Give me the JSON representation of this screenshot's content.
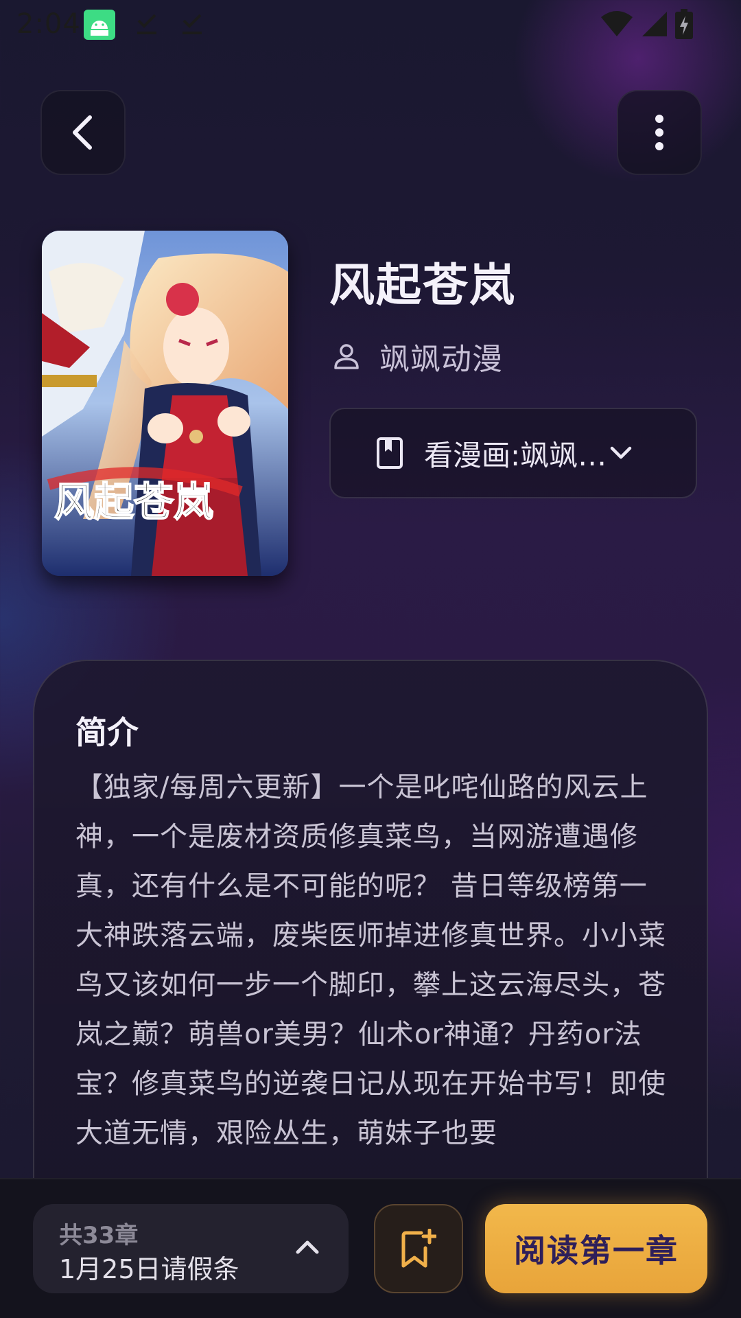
{
  "status_bar": {
    "time": "2:04"
  },
  "header": {
    "back_icon": "chevron-left-icon",
    "more_icon": "more-vertical-icon"
  },
  "comic": {
    "title": "风起苍岚",
    "author": "飒飒动漫",
    "source_label": "看漫画:飒飒…",
    "cover_title_art": "风起苍岚"
  },
  "intro": {
    "title": "简介",
    "text": "【独家/每周六更新】一个是叱咤仙路的风云上神，一个是废材资质修真菜鸟，当网游遭遇修真，还有什么是不可能的呢？ 昔日等级榜第一大神跌落云端，废柴医师掉进修真世界。小小菜鸟又该如何一步一个脚印，攀上这云海尽头，苍岚之巅？萌兽or美男？仙术or神通？丹药or法宝？修真菜鸟的逆袭日记从现在开始书写！即使大道无情，艰险丛生，萌妹子也要"
  },
  "bottom_bar": {
    "chapter_count": "共33章",
    "latest_chapter": "1月25日请假条",
    "read_button": "阅读第一章"
  },
  "colors": {
    "accent": "#f2b84b",
    "read_text": "#2e1f5a",
    "background": "#1d1833"
  }
}
